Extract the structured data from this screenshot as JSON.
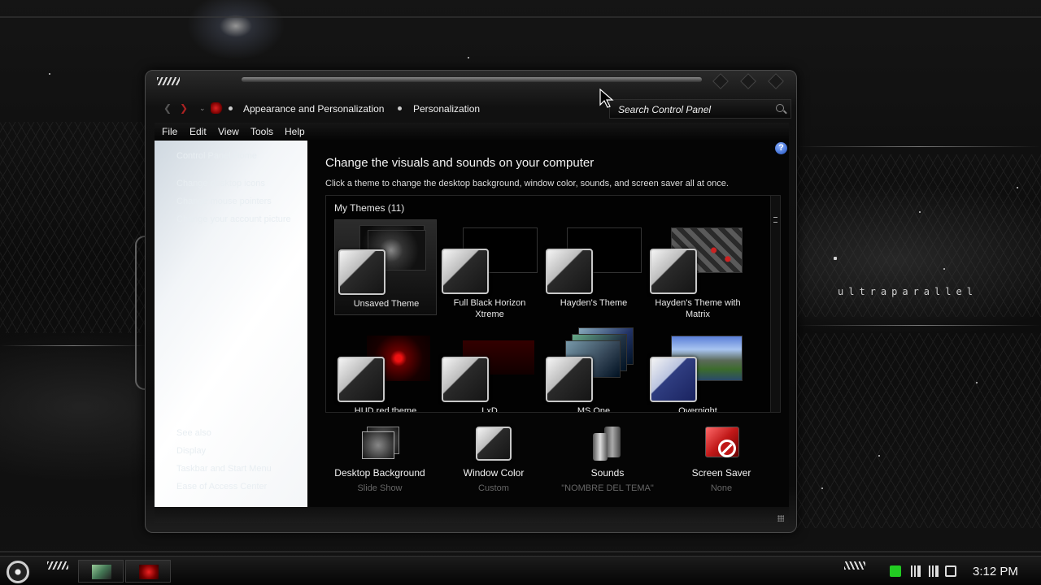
{
  "desktop": {
    "brand_text": "ultraparallel"
  },
  "window": {
    "address": {
      "crumbs": [
        "Appearance and Personalization",
        "Personalization"
      ],
      "search_placeholder": "Search Control Panel"
    },
    "menu": [
      "File",
      "Edit",
      "View",
      "Tools",
      "Help"
    ],
    "nav": {
      "links": [
        "Control Panel Home",
        "Change desktop icons",
        "Change mouse pointers",
        "Change your account picture"
      ],
      "see_also_title": "See also",
      "see_also": [
        "Display",
        "Taskbar and Start Menu",
        "Ease of Access Center"
      ]
    },
    "content": {
      "help_glyph": "?",
      "title": "Change the visuals and sounds on your computer",
      "description": "Click a theme to change the desktop background, window color, sounds, and screen saver all at once.",
      "themes_header": "My Themes (11)",
      "themes": [
        {
          "label": "Unsaved Theme",
          "selected": true
        },
        {
          "label": "Full Black Horizon Xtreme",
          "selected": false
        },
        {
          "label": "Hayden's Theme",
          "selected": false
        },
        {
          "label": "Hayden's Theme with Matrix",
          "selected": false
        },
        {
          "label": "HUD red theme",
          "selected": false
        },
        {
          "label": "LxD",
          "selected": false
        },
        {
          "label": "MS One",
          "selected": false
        },
        {
          "label": "Overnight",
          "selected": false
        }
      ],
      "settings": [
        {
          "label": "Desktop Background",
          "value": "Slide Show",
          "icon": "desktop-background-icon"
        },
        {
          "label": "Window Color",
          "value": "Custom",
          "icon": "window-color-icon"
        },
        {
          "label": "Sounds",
          "value": "\"NOMBRE DEL TEMA\"",
          "icon": "speakers-icon"
        },
        {
          "label": "Screen Saver",
          "value": "None",
          "icon": "screen-saver-icon"
        }
      ]
    }
  },
  "taskbar": {
    "clock": "3:12 PM"
  },
  "colors": {
    "accent_red": "#cc1f1f",
    "nav_pane": "#f2f5f8",
    "content_bg": "#050505"
  }
}
